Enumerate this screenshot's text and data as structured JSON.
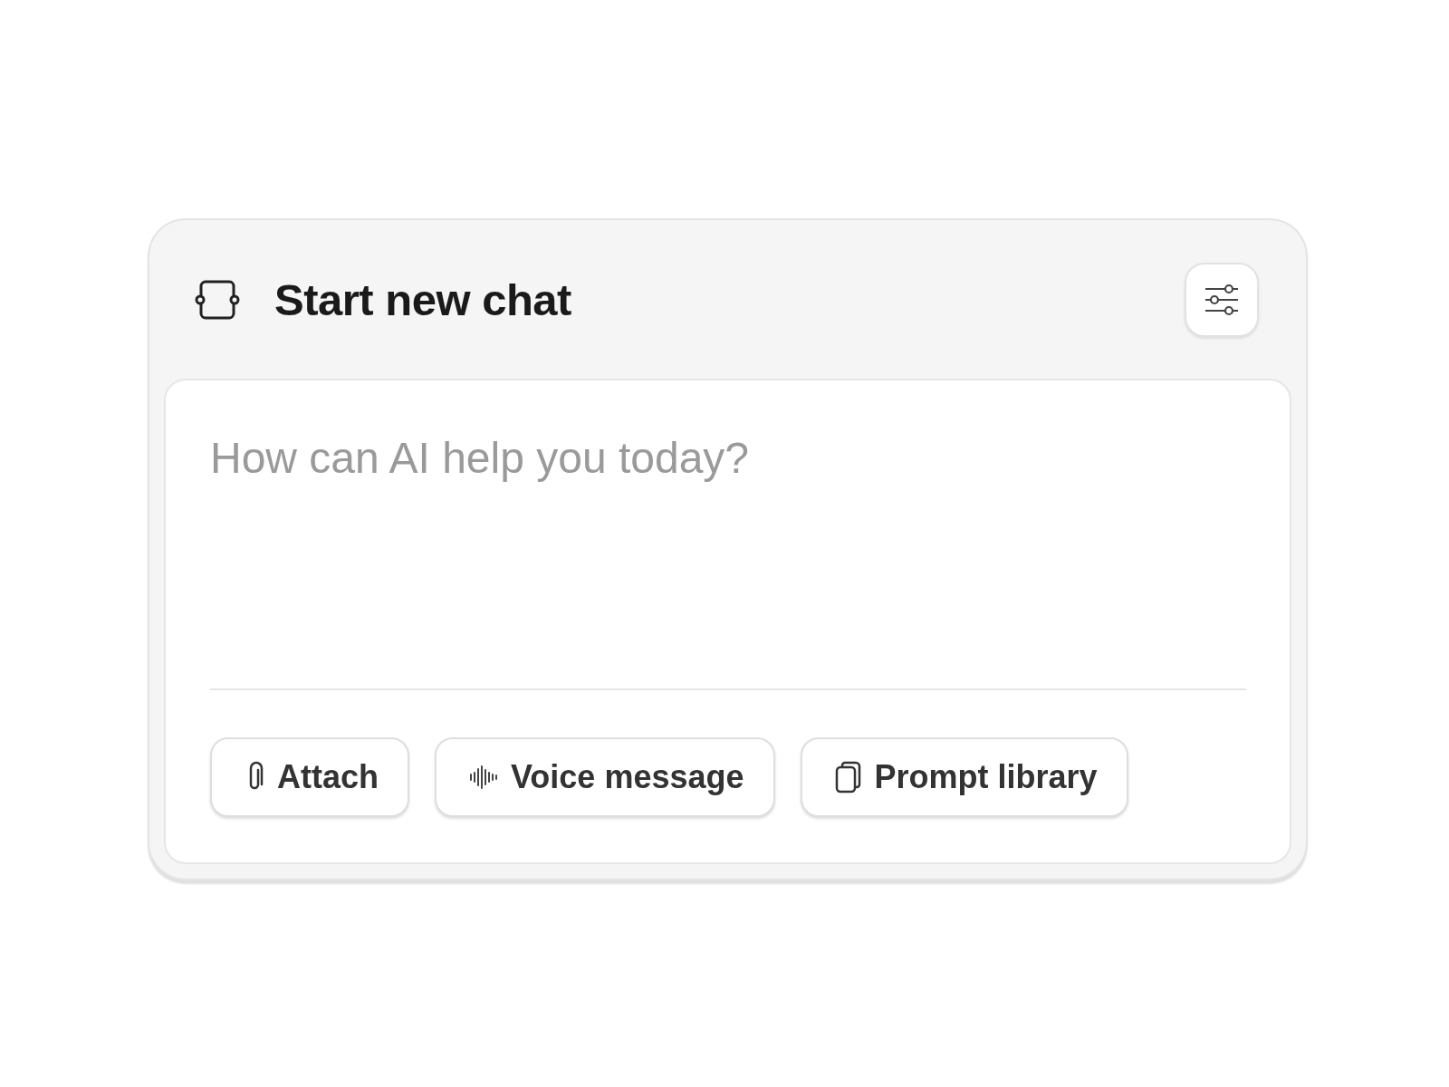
{
  "header": {
    "title": "Start new chat"
  },
  "composer": {
    "placeholder": "How can AI help you today?"
  },
  "actions": [
    {
      "kind": "attach",
      "label": "Attach"
    },
    {
      "kind": "voice",
      "label": "Voice message"
    },
    {
      "kind": "library",
      "label": "Prompt library"
    }
  ]
}
